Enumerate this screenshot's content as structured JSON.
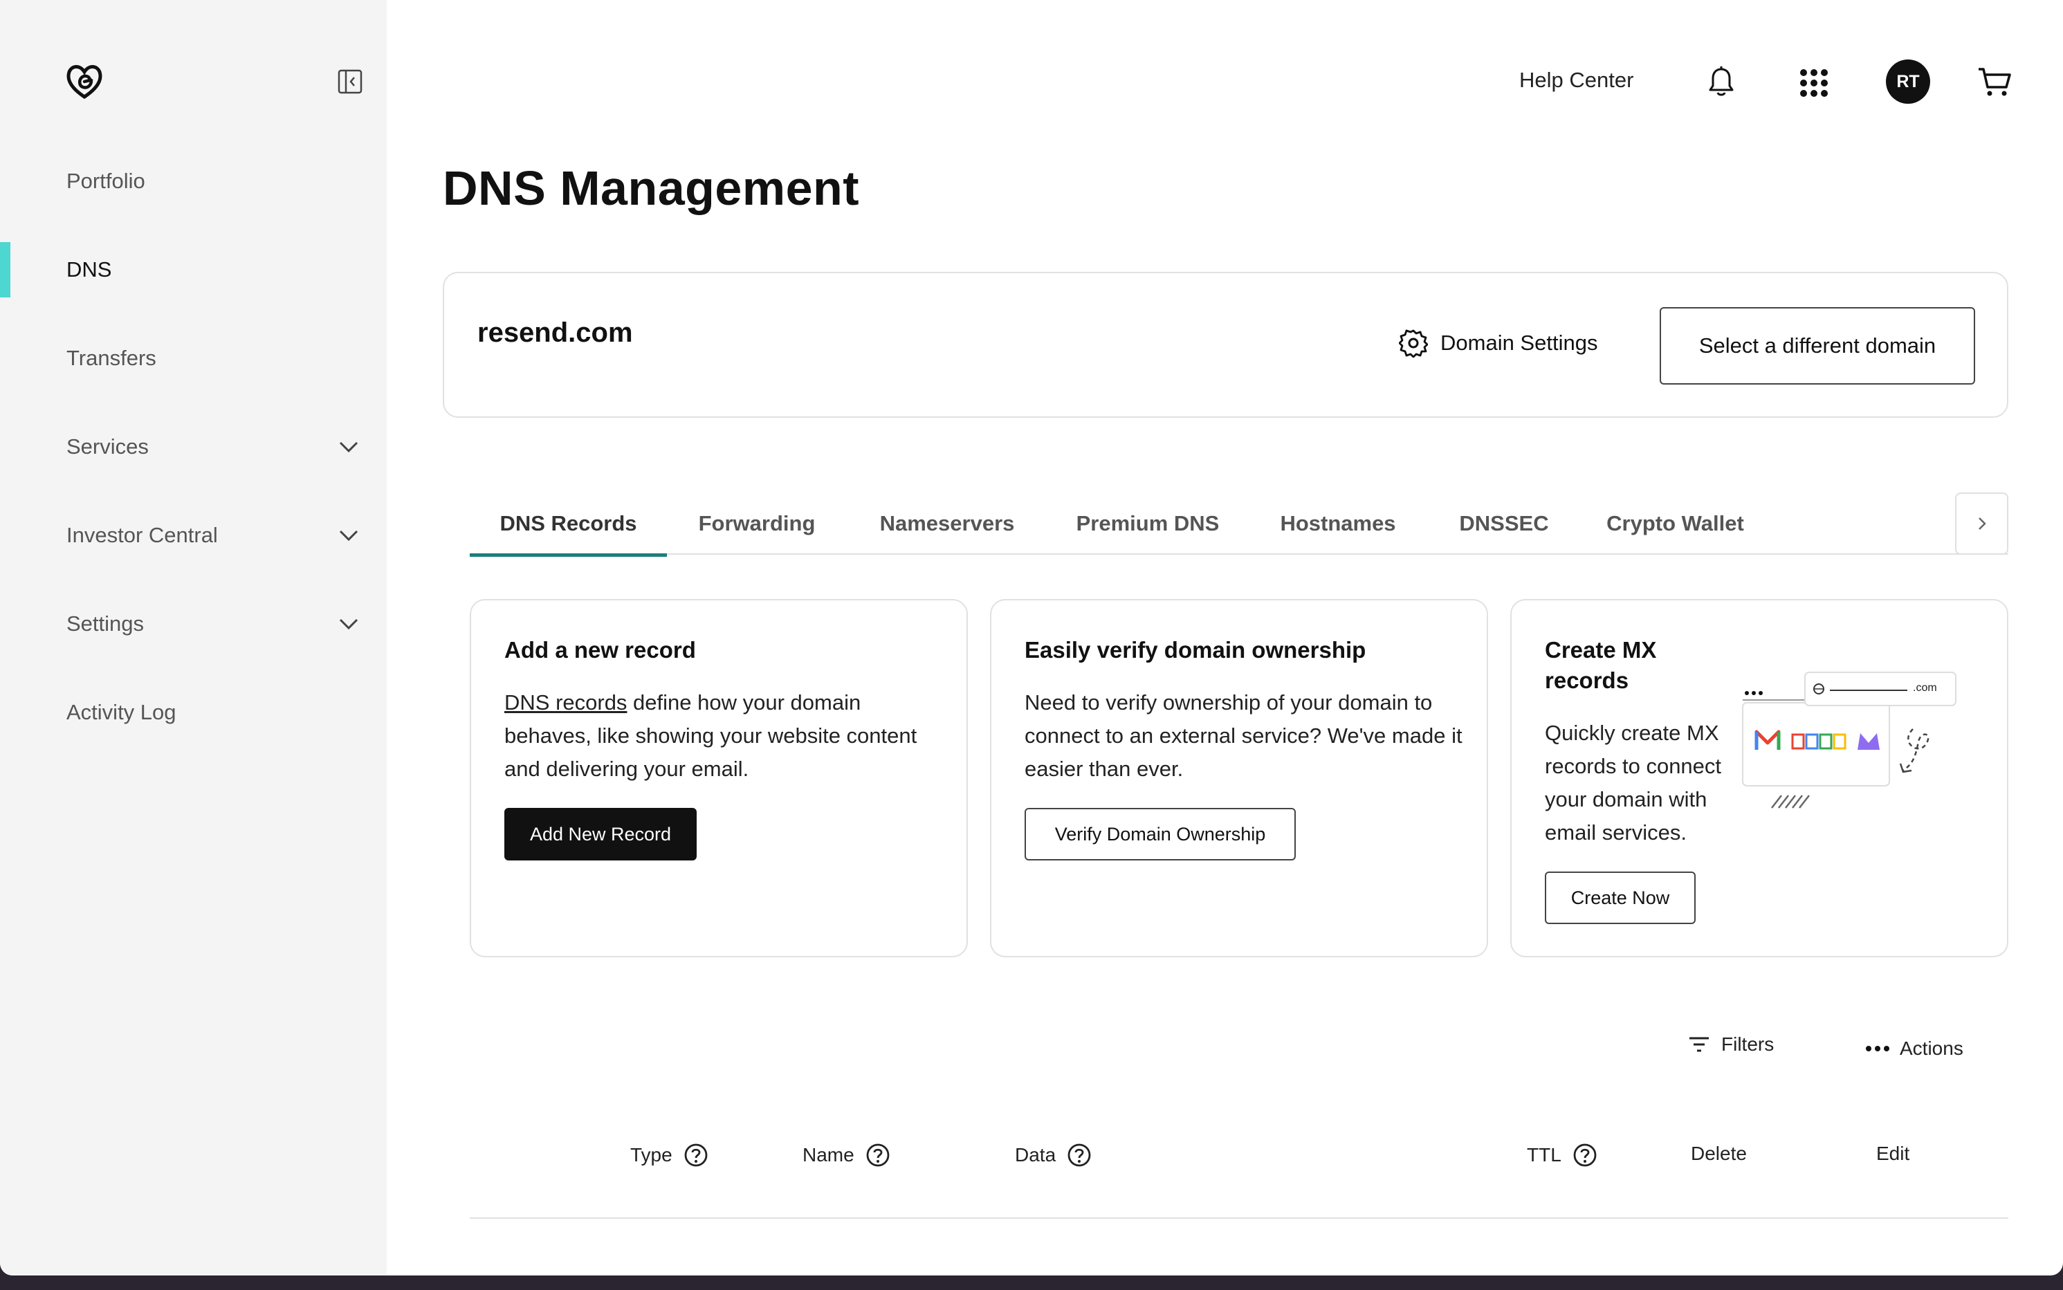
{
  "sidebar": {
    "items": [
      {
        "label": "Portfolio"
      },
      {
        "label": "DNS"
      },
      {
        "label": "Transfers"
      },
      {
        "label": "Services"
      },
      {
        "label": "Investor Central"
      },
      {
        "label": "Settings"
      },
      {
        "label": "Activity Log"
      }
    ],
    "active_accent": "#4ed6d0"
  },
  "topbar": {
    "help_label": "Help Center",
    "avatar_initials": "RT",
    "icons": [
      "bell-icon",
      "apps-grid-icon",
      "cart-icon"
    ]
  },
  "page": {
    "title": "DNS Management"
  },
  "domain": {
    "name": "resend.com",
    "settings_label": "Domain Settings",
    "select_label": "Select a different domain"
  },
  "tabs": [
    {
      "label": "DNS Records"
    },
    {
      "label": "Forwarding"
    },
    {
      "label": "Nameservers"
    },
    {
      "label": "Premium DNS"
    },
    {
      "label": "Hostnames"
    },
    {
      "label": "DNSSEC"
    },
    {
      "label": "Crypto Wallet"
    }
  ],
  "cards": {
    "add": {
      "title": "Add a new record",
      "link_text": "DNS records",
      "text_rest": " define how your domain behaves, like showing your website content and delivering your email.",
      "button": "Add New Record"
    },
    "verify": {
      "title": "Easily verify domain ownership",
      "text": "Need to verify ownership of your domain to connect to an external service? We've made it easier than ever.",
      "button": "Verify Domain Ownership"
    },
    "mx": {
      "title": "Create MX records",
      "text": "Quickly create MX records to connect your domain with email services.",
      "button": "Create Now",
      "illustration_text": ".com"
    }
  },
  "table": {
    "filters_label": "Filters",
    "actions_label": "Actions",
    "columns": [
      {
        "label": "Type"
      },
      {
        "label": "Name"
      },
      {
        "label": "Data"
      },
      {
        "label": "TTL"
      },
      {
        "label": "Delete"
      },
      {
        "label": "Edit"
      }
    ]
  }
}
